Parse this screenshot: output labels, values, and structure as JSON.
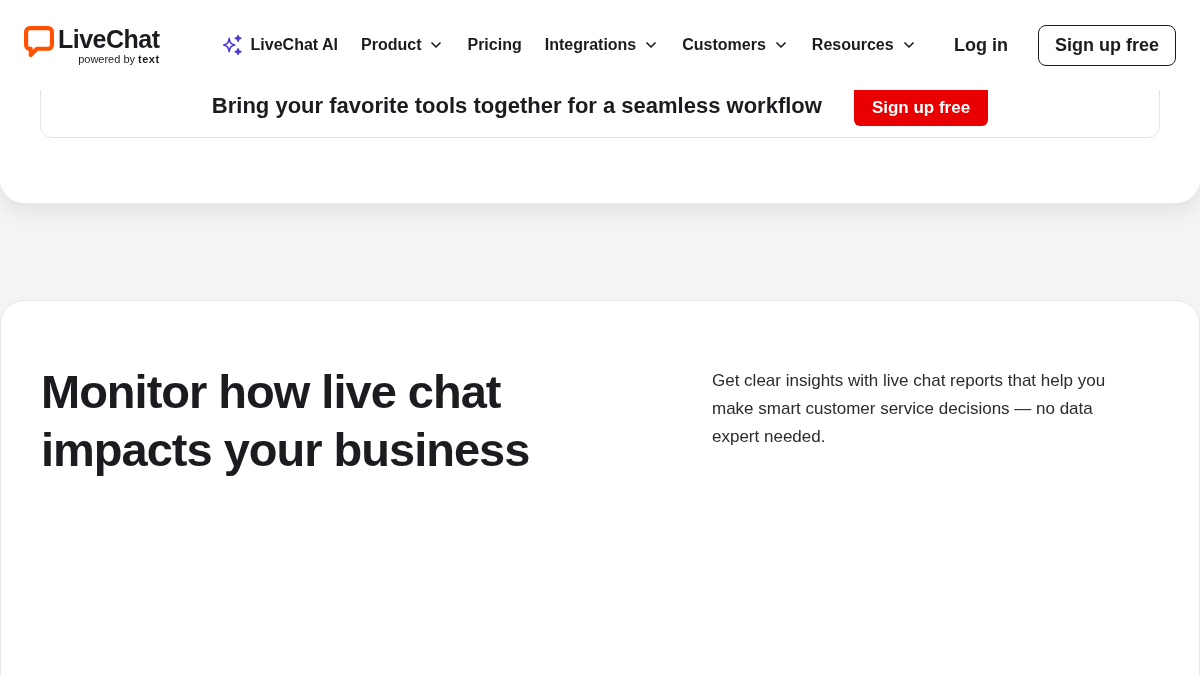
{
  "header": {
    "logo": {
      "name": "LiveChat",
      "tagline": "powered by",
      "brand": "text"
    },
    "nav": [
      {
        "label": "LiveChat AI",
        "kind": "ai"
      },
      {
        "label": "Product",
        "kind": "dropdown"
      },
      {
        "label": "Pricing",
        "kind": "link"
      },
      {
        "label": "Integrations",
        "kind": "dropdown"
      },
      {
        "label": "Customers",
        "kind": "dropdown"
      },
      {
        "label": "Resources",
        "kind": "dropdown"
      }
    ],
    "login": "Log in",
    "signup": "Sign up free"
  },
  "integrations_banner": {
    "text": "Bring your favorite tools together for a seamless workflow",
    "button": "Sign up free"
  },
  "reports_section": {
    "heading": "Monitor how live chat impacts your business",
    "description": "Get clear insights with live chat reports that help you make smart customer service decisions — no data expert needed."
  }
}
